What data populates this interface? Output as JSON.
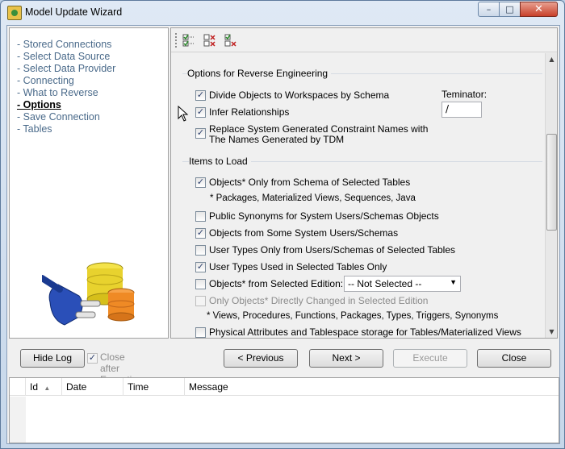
{
  "window": {
    "title": "Model Update Wizard",
    "minimize_glyph": "–",
    "maximize_glyph": "□",
    "close_glyph": "✕"
  },
  "nav": {
    "items": [
      {
        "label": "- Stored Connections",
        "active": false
      },
      {
        "label": "- Select Data Source",
        "active": false
      },
      {
        "label": "- Select Data Provider",
        "active": false
      },
      {
        "label": "- Connecting",
        "active": false
      },
      {
        "label": "- What to Reverse",
        "active": false
      },
      {
        "label": "- Options",
        "active": true
      },
      {
        "label": "- Save Connection",
        "active": false
      },
      {
        "label": "- Tables",
        "active": false
      }
    ]
  },
  "toolbar": {
    "icons": [
      "check-all-icon",
      "uncheck-all-icon",
      "invert-selection-icon"
    ]
  },
  "options": {
    "reverse_title": "Options for Reverse Engineering",
    "divide_objects": {
      "label": "Divide Objects to Workspaces by Schema",
      "checked": true
    },
    "infer_relationships": {
      "label": "Infer Relationships",
      "checked": true
    },
    "replace_names": {
      "label_line1": "Replace System Generated Constraint Names with",
      "label_line2": "The Names Generated by TDM",
      "checked": true
    },
    "terminator_label": "Teminator:",
    "terminator_value": "/",
    "items_title": "Items to Load",
    "objects_only": {
      "label": "Objects* Only from Schema of Selected Tables",
      "checked": true
    },
    "objects_note": "* Packages, Materialized Views, Sequences, Java",
    "public_synonyms": {
      "label": "Public Synonyms for System Users/Schemas Objects",
      "checked": false
    },
    "objects_system": {
      "label": "Objects from Some System Users/Schemas",
      "checked": true
    },
    "user_types_only": {
      "label": "User Types Only from Users/Schemas of Selected Tables",
      "checked": false
    },
    "user_types_used": {
      "label": "User Types Used in Selected Tables Only",
      "checked": true
    },
    "objects_edition": {
      "label": "Objects* from Selected Edition:",
      "checked": false
    },
    "edition_select": "-- Not Selected --",
    "only_changed": {
      "label": "Only Objects* Directly Changed in Selected Edition",
      "checked": false,
      "disabled": true
    },
    "views_note": "* Views, Procedures, Functions, Packages, Types, Triggers, Synonyms",
    "physical_attrs": {
      "label": "Physical Attributes and Tablespace storage for Tables/Materialized Views",
      "checked": false
    }
  },
  "buttons": {
    "hide_log": "Hide Log",
    "close_after": "Close after Execution",
    "close_after_checked": true,
    "previous": "< Previous",
    "next": "Next >",
    "execute": "Execute",
    "close": "Close"
  },
  "log": {
    "columns": [
      "Id",
      "Date",
      "Time",
      "Message"
    ],
    "sort_glyph": "▲"
  },
  "colors": {
    "nav_link": "#4a6a8a",
    "check_mark": "#2b3d6b"
  }
}
